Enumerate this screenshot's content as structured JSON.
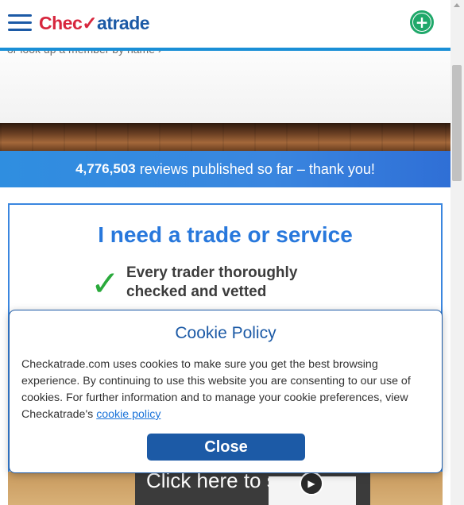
{
  "header": {
    "logo_part1": "Chec",
    "logo_tick": "✓",
    "logo_part2": "atrade",
    "menu_icon": "hamburger-menu-icon",
    "add_icon": "plus-circle-icon",
    "add_symbol": "+"
  },
  "hero": {
    "link_text": "or look up a member by name ›"
  },
  "reviews": {
    "count": "4,776,503",
    "text": "reviews published so far – thank you!"
  },
  "card": {
    "title": "I need a trade or service",
    "check_symbol": "✓",
    "vetted_text": "Every trader thoroughly checked and vetted"
  },
  "promo": {
    "text": "Click here to see how",
    "play_symbol": "▶"
  },
  "cookie": {
    "title": "Cookie Policy",
    "body": "Checkatrade.com uses cookies to make sure you get the best browsing experience. By continuing to use this website you are consenting to our use of cookies. For further information and to manage your cookie preferences, view Checkatrade's ",
    "link": "cookie policy",
    "close_label": "Close"
  },
  "colors": {
    "brand_blue": "#1c5aa6",
    "brand_red": "#d7263d",
    "accent_green": "#1fa86a",
    "banner_blue": "#3a86df"
  }
}
